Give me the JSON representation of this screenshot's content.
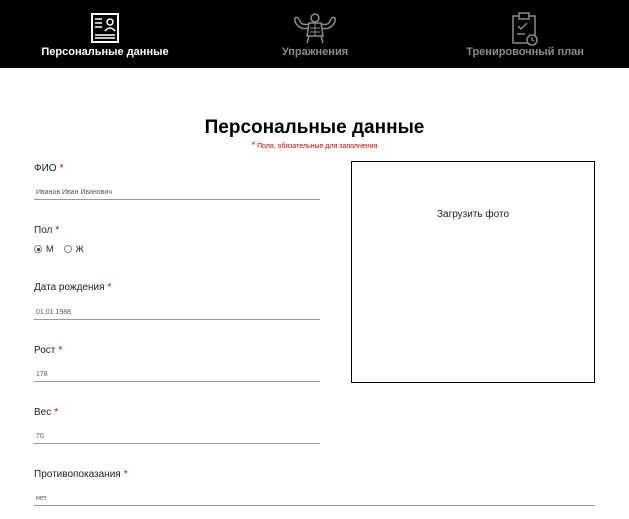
{
  "nav": {
    "items": [
      {
        "label": "Персональные данные",
        "icon": "profile-card-icon",
        "active": true
      },
      {
        "label": "Упражнения",
        "icon": "muscle-man-icon",
        "active": false
      },
      {
        "label": "Тренировочный план",
        "icon": "clipboard-check-icon",
        "active": false
      }
    ]
  },
  "page": {
    "title": "Персональные данные",
    "required_star": "*",
    "required_note": "Поля, обязательные для заполнения"
  },
  "form": {
    "required_mark": "*",
    "fio": {
      "label": "ФИО",
      "value": "Иванов Иван Иванович"
    },
    "gender": {
      "label": "Пол",
      "options": [
        "М",
        "Ж"
      ],
      "selected": "М"
    },
    "birthdate": {
      "label": "Дата рождения",
      "value": "01.01.1988"
    },
    "height": {
      "label": "Рост",
      "value": "178"
    },
    "weight": {
      "label": "Вес",
      "value": "70"
    },
    "contraindications": {
      "label": "Противопоказания",
      "value": "нет"
    }
  },
  "photo": {
    "label": "Загрузить фото"
  },
  "colors": {
    "nav_bg": "#000000",
    "required": "#d40000",
    "active_text": "#ffffff",
    "inactive_text": "#8a8a8a"
  }
}
